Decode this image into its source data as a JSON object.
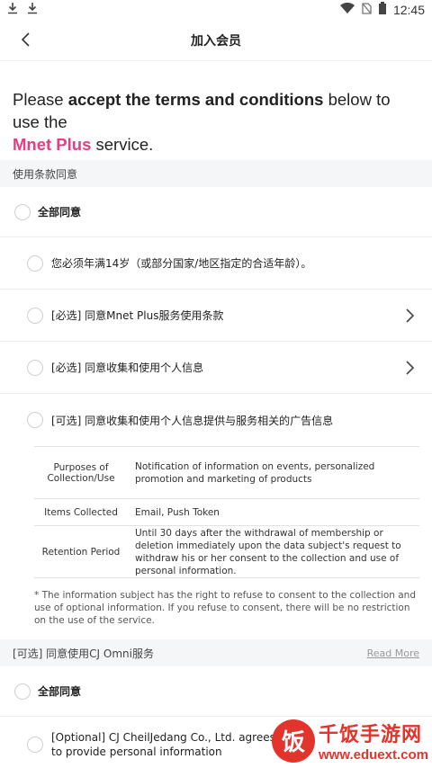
{
  "status_bar": {
    "time": "12:45"
  },
  "header": {
    "title": "加入会员"
  },
  "intro": {
    "prefix": "Please ",
    "bold": "accept the terms and conditions",
    "suffix": " below to use the",
    "brand": "Mnet Plus",
    "end": " service."
  },
  "terms_section": {
    "title": "使用条款同意",
    "agree_all": "全部同意",
    "items": [
      {
        "label": "您必须年满14岁（或部分国家/地区指定的合适年龄）。"
      },
      {
        "label": "[必选] 同意Mnet Plus服务使用条款"
      },
      {
        "label": "[必选] 同意收集和使用个人信息"
      },
      {
        "label": "[可选] 同意收集和使用个人信息提供与服务相关的广告信息"
      }
    ],
    "info_table": [
      {
        "head": "Purposes of Collection/Use",
        "value": "Notification of information on events, personalized promotion and marketing of products"
      },
      {
        "head": "Items Collected",
        "value": "Email, Push Token"
      },
      {
        "head": "Retention Period",
        "value": "Until 30 days after the withdrawal of membership or deletion immediately upon the data subject's request to withdraw his or her consent to the collection and use of personal information."
      }
    ],
    "notice": "* The information subject has the right to refuse to consent to the collection and use of optional information. If you refuse to consent, there will be no restriction on the use of the service."
  },
  "cj_section": {
    "title": "[可选] 同意使用CJ Omni服务",
    "read_more": "Read More",
    "agree_all": "全部同意",
    "item": "[Optional] CJ CheilJedang Co., Ltd. agrees to provide personal information"
  },
  "watermark": {
    "logo": "饭",
    "name": "千饭手游网",
    "url": "www.eduext.com"
  },
  "colors": {
    "brand": "#e53d83",
    "watermark": "#e0342c"
  }
}
